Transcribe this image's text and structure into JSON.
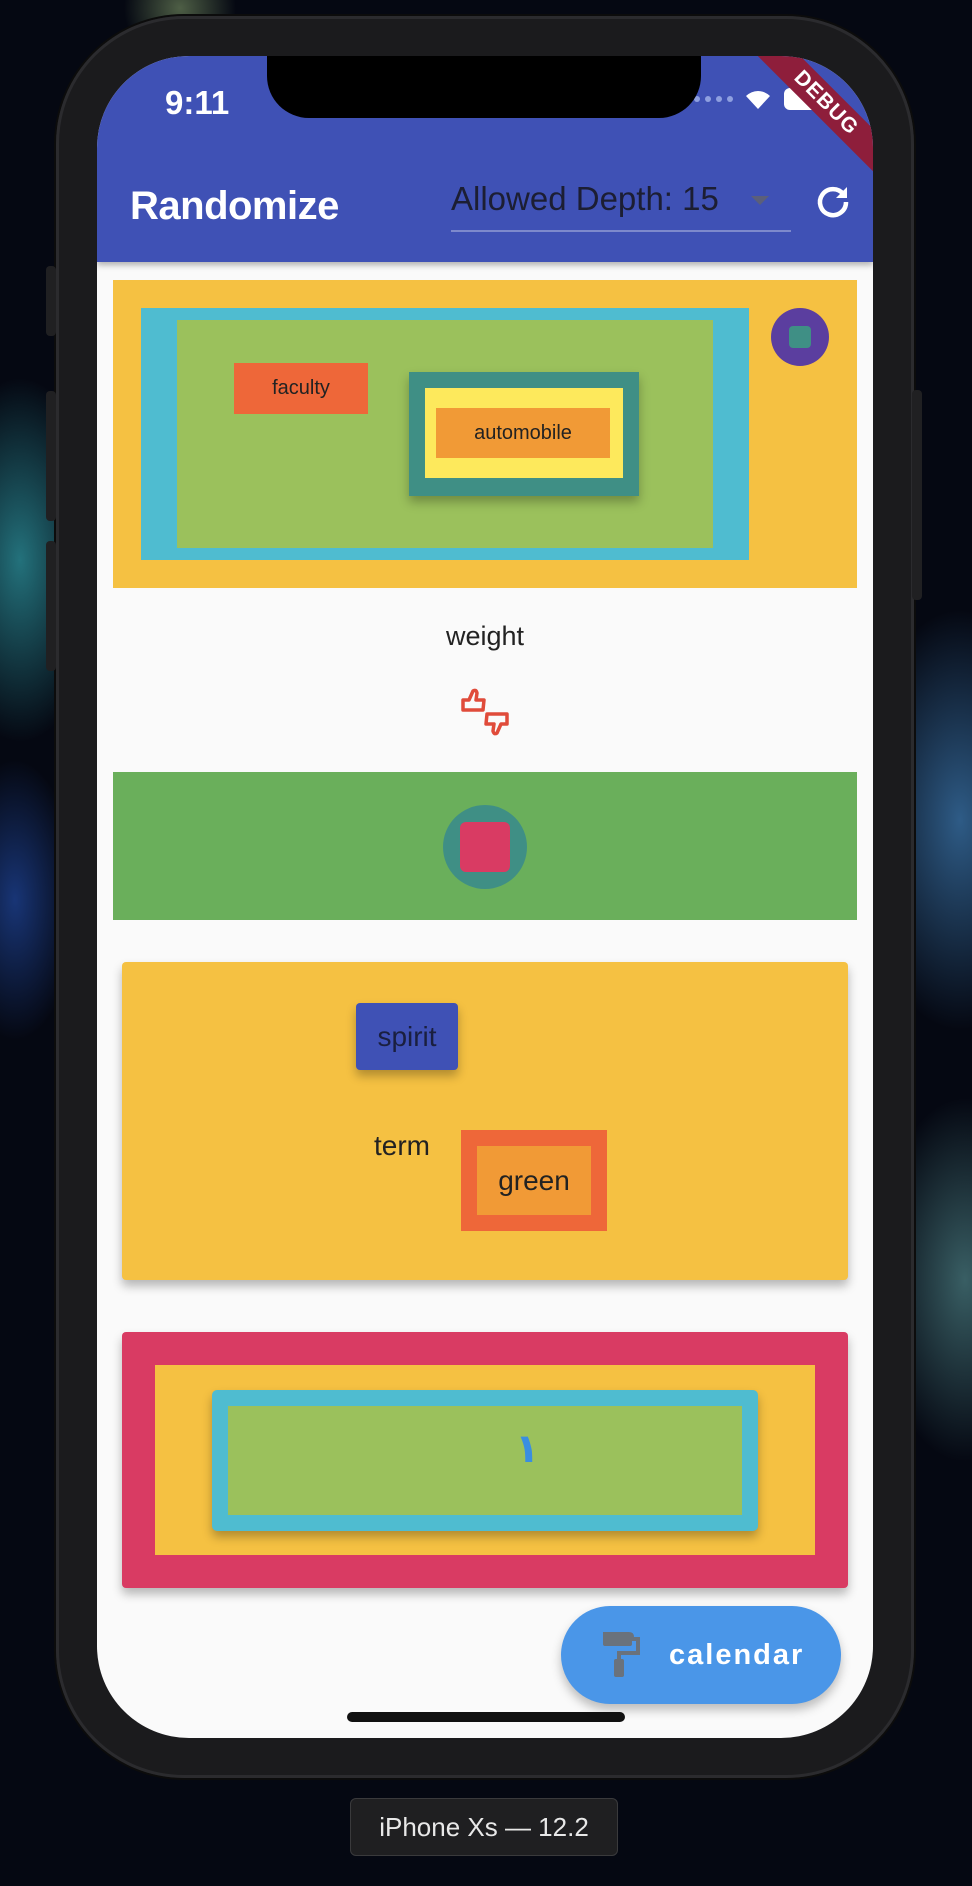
{
  "status_bar": {
    "time": "9:11",
    "debug_banner": "DEBUG"
  },
  "app_bar": {
    "title": "Randomize",
    "depth_dropdown": {
      "label": "Allowed Depth: 15"
    }
  },
  "content": {
    "block1": {
      "word_a": "faculty",
      "word_b": "automobile"
    },
    "block2": {
      "word": "weight"
    },
    "block4": {
      "word_a": "spirit",
      "word_b": "term",
      "word_c": "green"
    },
    "block5": {
      "glyph": "١"
    }
  },
  "fab": {
    "label": "calendar"
  },
  "simulator": {
    "device_label": "iPhone Xs — 12.2"
  },
  "colors": {
    "app_bar": "#3f51b5",
    "amber": "#f5c142",
    "cyan": "#4fbcd0",
    "light_green": "#9bc15c",
    "green": "#6aaf5b",
    "teal": "#3f8f85",
    "yellow": "#fde95c",
    "orange": "#f19a36",
    "deep_orange": "#ee6739",
    "indigo": "#3f51b5",
    "purple": "#5b3e9f",
    "pink": "#d93b63",
    "fab_blue": "#4a96e8"
  },
  "icons": [
    "wifi-icon",
    "battery-icon",
    "refresh-icon",
    "thumbs-up-down-icon",
    "paint-roller-icon"
  ]
}
